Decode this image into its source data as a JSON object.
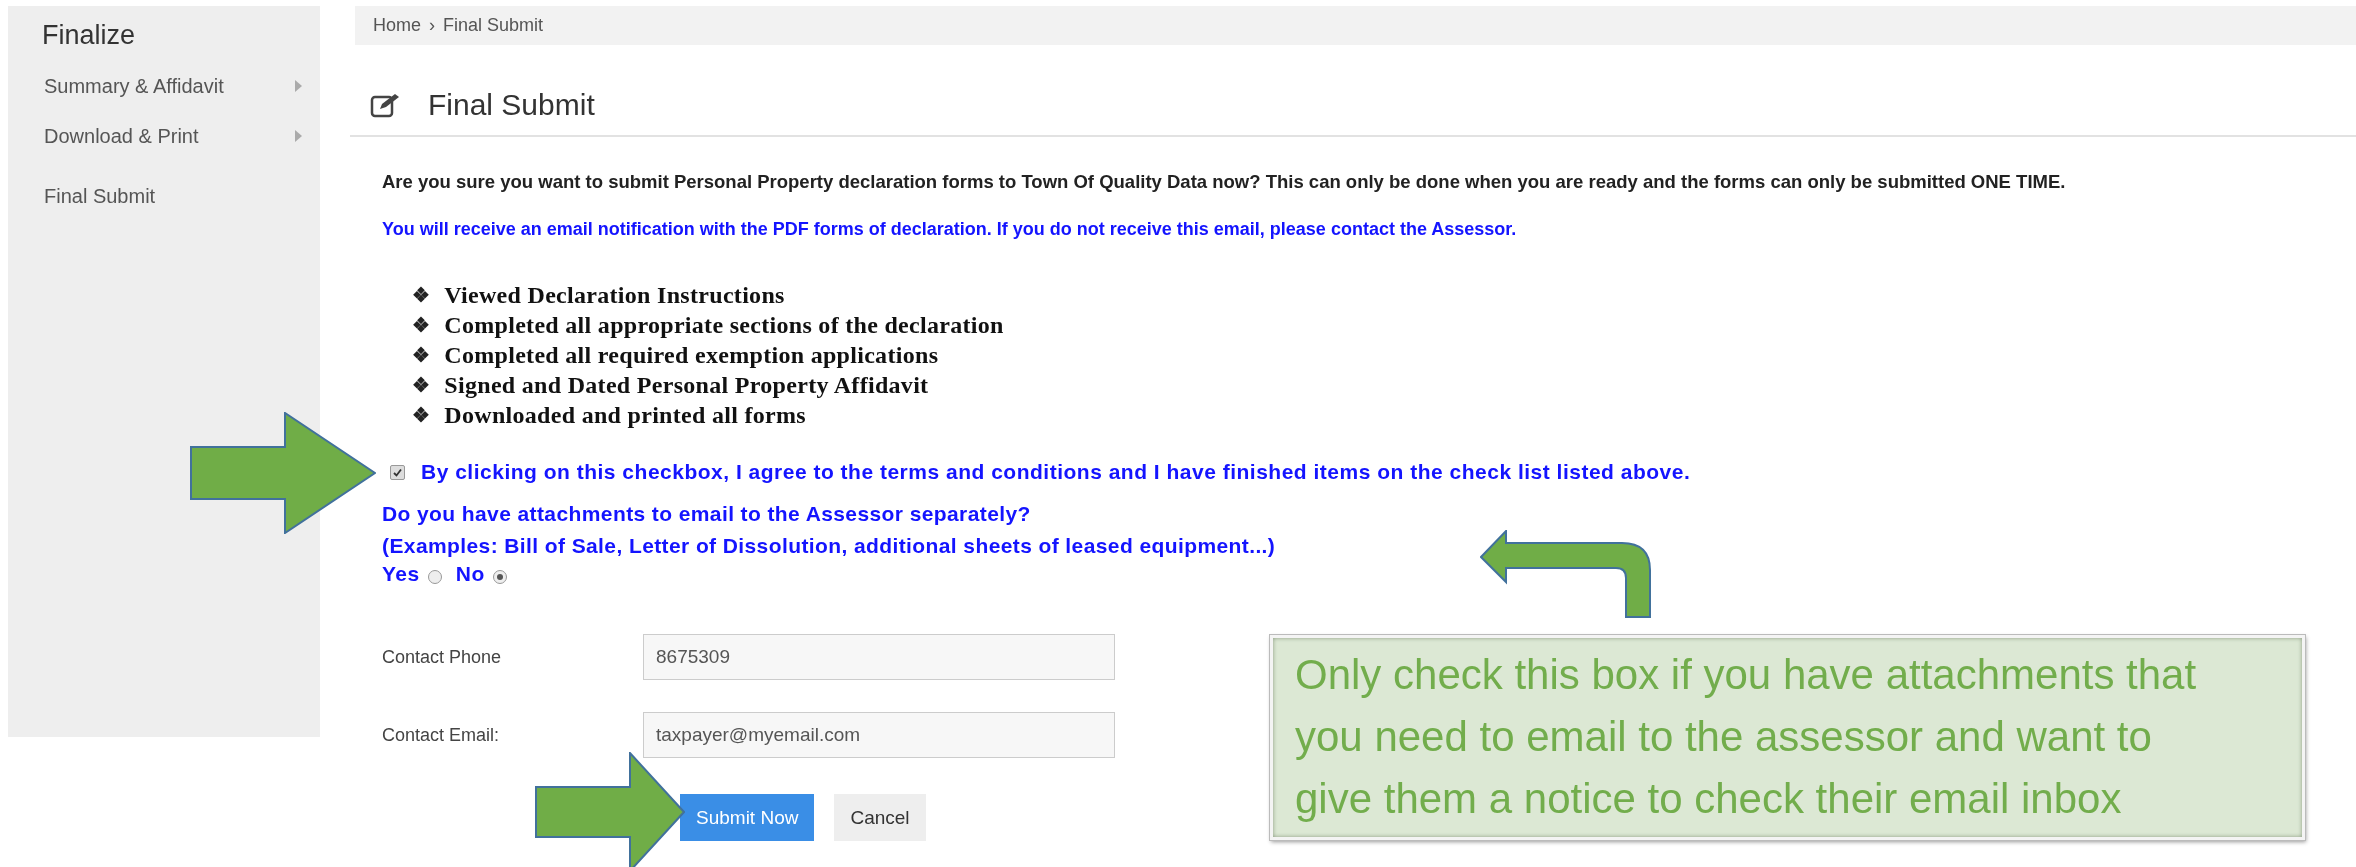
{
  "sidebar": {
    "title": "Finalize",
    "items": [
      {
        "label": "Summary & Affidavit",
        "kind": "submenu"
      },
      {
        "label": "Download & Print",
        "kind": "submenu"
      },
      {
        "label": "Final Submit",
        "kind": "link"
      }
    ]
  },
  "breadcrumb": {
    "items": [
      "Home",
      "Final Submit"
    ],
    "separator": "›"
  },
  "page_title": "Final Submit",
  "intro": "Are you sure you want to submit Personal Property declaration forms to Town Of Quality Data now? This can only be done when you are ready and the forms can only be submitted ONE TIME.",
  "notice": "You will receive an email notification with the PDF forms of declaration. If you do not receive this email, please contact the Assessor.",
  "checklist": [
    "Viewed Declaration Instructions",
    "Completed all appropriate sections of the declaration",
    "Completed all required  exemption applications",
    "Signed and Dated Personal Property Affidavit",
    "Downloaded and printed all forms"
  ],
  "checklist_bullet": "❖",
  "agreement": {
    "label": "By clicking on this checkbox, I agree to the terms and conditions and I have finished items on the check list listed above.",
    "checked": true
  },
  "attachments_question": [
    "Do you have attachments to email to the Assessor separately?",
    "(Examples: Bill of Sale, Letter of Dissolution, additional sheets of leased equipment...)"
  ],
  "attachments_options": [
    {
      "label": "Yes",
      "selected": false
    },
    {
      "label": "No",
      "selected": true
    }
  ],
  "fields": [
    {
      "label": "Contact Phone",
      "value": "8675309"
    },
    {
      "label": "Contact Email:",
      "value": "taxpayer@myemail.com"
    }
  ],
  "buttons": [
    {
      "label": "Submit Now",
      "kind": "primary"
    },
    {
      "label": "Cancel",
      "kind": "secondary"
    }
  ],
  "callout": "Only check this box if you have attachments that you need to email to the assessor and want to give them a notice to check their email inbox"
}
